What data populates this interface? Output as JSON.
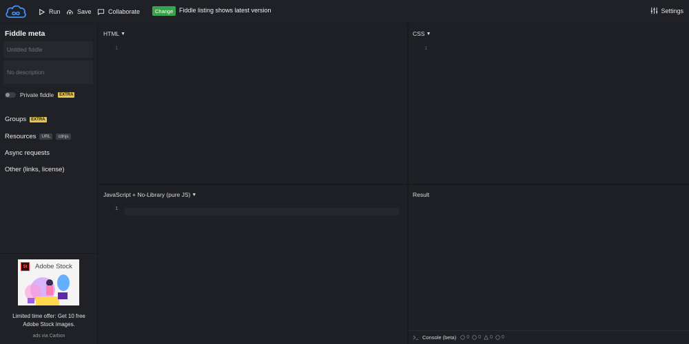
{
  "header": {
    "run_label": "Run",
    "save_label": "Save",
    "collaborate_label": "Collaborate",
    "change_badge": "Change",
    "notice": "Fiddle listing shows latest version",
    "settings_label": "Settings"
  },
  "sidebar": {
    "title": "Fiddle meta",
    "title_placeholder": "Untitled fiddle",
    "description_placeholder": "No description",
    "private_label": "Private fiddle",
    "extra_tag": "EXTRA",
    "groups_label": "Groups",
    "resources_label": "Resources",
    "url_tag": "URL",
    "cdnjs_tag": "cdnjs",
    "async_label": "Async requests",
    "other_label": "Other (links, license)"
  },
  "ad": {
    "brand": "Adobe Stock",
    "brand_mark": "St",
    "text": "Limited time offer: Get 10 free Adobe Stock images.",
    "via": "ads via Carbon"
  },
  "panels": {
    "html_label": "HTML",
    "css_label": "CSS",
    "js_label": "JavaScript + No-Library (pure JS)",
    "result_label": "Result",
    "line_one": "1"
  },
  "console": {
    "label": "Console (beta)",
    "counts": [
      "0",
      "0",
      "0",
      "0"
    ]
  },
  "colors": {
    "accent_change": "#37a34a",
    "extra_tag": "#e8c547",
    "logo_blue": "#3d8ff2"
  }
}
